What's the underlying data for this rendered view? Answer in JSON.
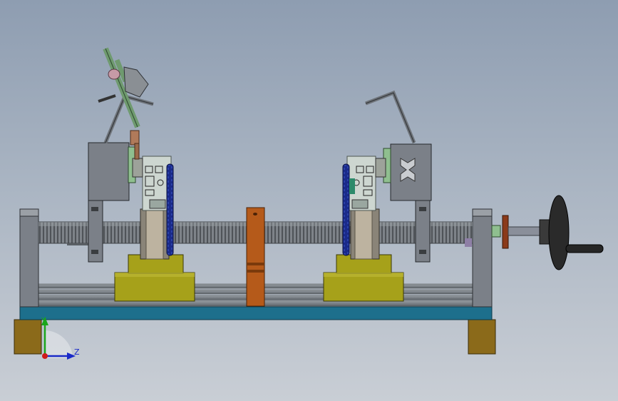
{
  "triad": {
    "y_label": "Y",
    "z_label": "Z"
  },
  "colors": {
    "base_plate": "#1d6f8c",
    "feet": "#8b6a1a",
    "carriage_block": "#a6a11a",
    "screw_shaft": "#6d7278",
    "frame_gray": "#7b8088",
    "center_post": "#b55a1a",
    "belt_blue": "#1a2a8a",
    "handwheel": "#2a2a2a",
    "light_green": "#8fbf8f"
  }
}
